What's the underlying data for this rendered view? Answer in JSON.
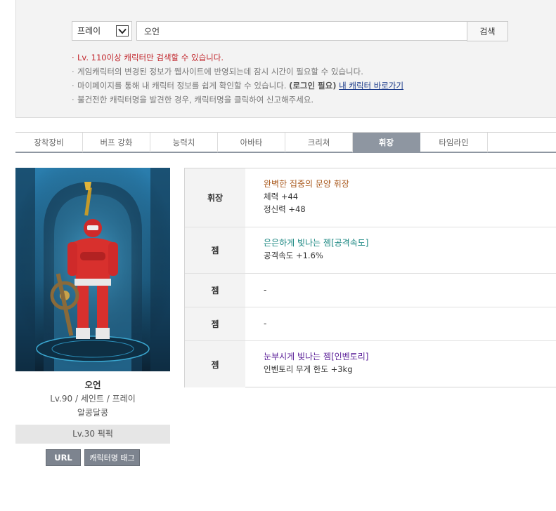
{
  "search": {
    "server_value": "프레이",
    "query_value": "오언",
    "button_label": "검색"
  },
  "notices": [
    "Lv. 110이상 캐릭터만 검색할 수 있습니다.",
    "게임캐릭터의 변경된 정보가 웹사이트에 반영되는데 잠시 시간이 필요할 수 있습니다.",
    "마이페이지를 통해 내 캐릭터 정보를 쉽게 확인할 수 있습니다. ",
    "(로그인 필요)",
    "내 캐릭터 바로가기",
    "불건전한 캐릭터명을 발견한 경우, 캐릭터명을 클릭하여 신고해주세요."
  ],
  "tabs": [
    "장착장비",
    "버프 강화",
    "능력치",
    "아바타",
    "크리쳐",
    "휘장",
    "타임라인"
  ],
  "active_tab": "휘장",
  "character": {
    "name": "오언",
    "info": "Lv.90 / 세인트 / 프레이",
    "guild": "알콩달콩",
    "adventure": "Lv.30 퍽퍽",
    "url_label": "URL",
    "tag_label": "캐릭터명 태그"
  },
  "equipment": [
    {
      "label": "휘장",
      "name": "완벽한 집중의 문양 휘장",
      "lines": [
        "체력 +44",
        "정신력 +48"
      ]
    },
    {
      "label": "젬",
      "name": "은은하게 빛나는 젬[공격속도]",
      "lines": [
        "공격속도 +1.6%"
      ]
    },
    {
      "label": "젬",
      "name": "-",
      "lines": []
    },
    {
      "label": "젬",
      "name": "-",
      "lines": []
    },
    {
      "label": "젬",
      "name": "눈부시게 빛나는 젬[인벤토리]",
      "lines": [
        "인벤토리 무게 한도 +3kg"
      ]
    }
  ],
  "colors": {
    "tab_active_bg": "#8e96a1",
    "notice_red": "#c2272d",
    "emblem_name": "#a8571a",
    "gem_teal": "#16857f",
    "gem_purple": "#5b2098"
  }
}
